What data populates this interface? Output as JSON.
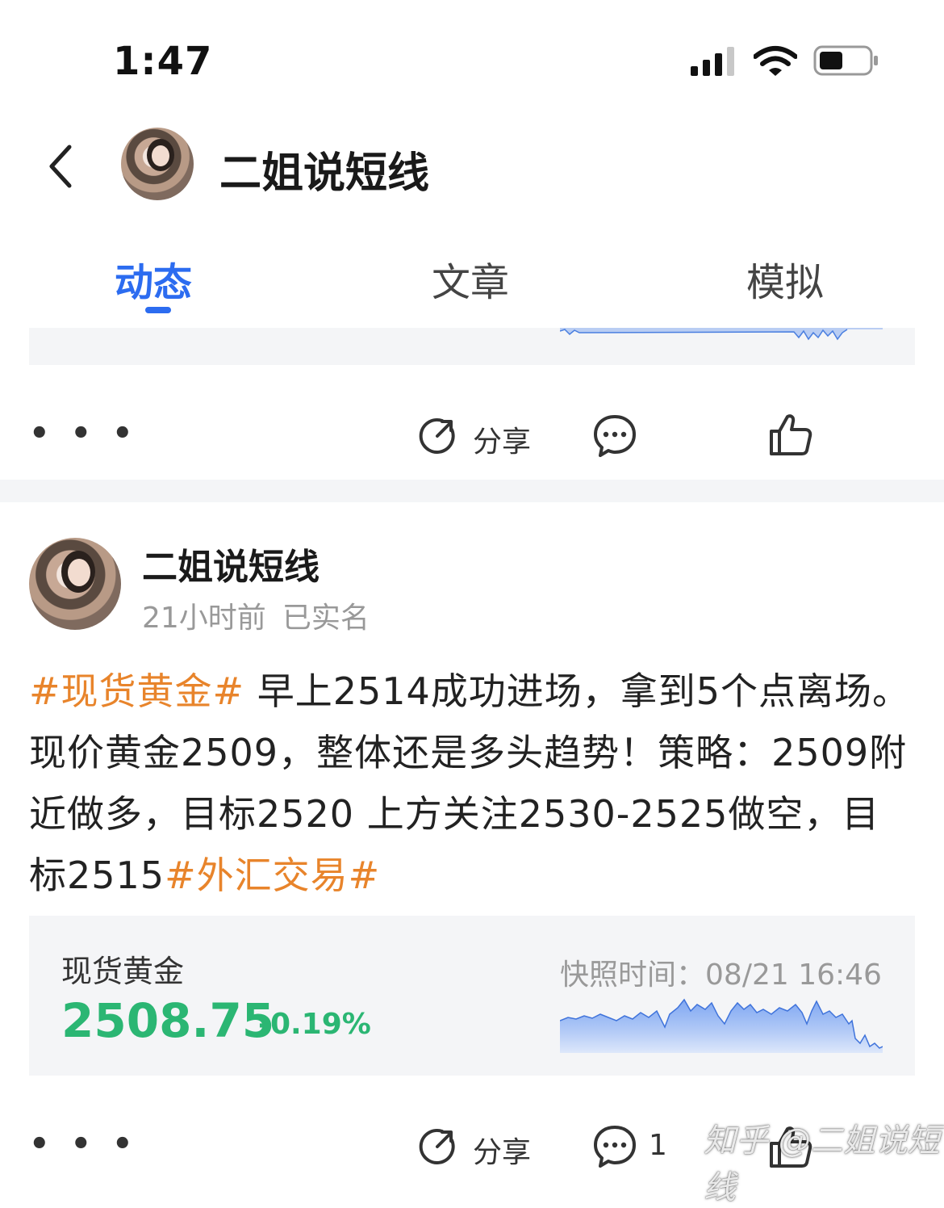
{
  "status_bar": {
    "time": "1:47"
  },
  "header": {
    "title": "二姐说短线"
  },
  "tabs": [
    {
      "label": "动态",
      "active": true
    },
    {
      "label": "文章",
      "active": false
    },
    {
      "label": "模拟",
      "active": false
    }
  ],
  "post1_actions": {
    "more": "• • •",
    "share_label": "分享"
  },
  "post2": {
    "author": "二姐说短线",
    "time": "21小时前",
    "verified": "已实名",
    "body": {
      "tag1": "#现货黄金#",
      "text1": " 早上2514成功进场，拿到5个点离场。现价黄金2509，整体还是多头趋势！策略：2509附近做多，目标2520 上方关注2530-2525做空，目标2515",
      "tag2": "#外汇交易#"
    },
    "quote": {
      "name": "现货黄金",
      "price": "2508.75",
      "change": "-0.19%",
      "snapshot_label": "快照时间：",
      "snapshot_time": "08/21 16:46"
    },
    "actions": {
      "more": "• • •",
      "share_label": "分享",
      "comment_count": "1"
    }
  },
  "watermark": "知乎 @二姐说短线",
  "colors": {
    "accent": "#2c6cf0",
    "tag": "#e8842b",
    "price_down": "#2bb673"
  },
  "icons": [
    "back-icon",
    "signal-icon",
    "wifi-icon",
    "battery-icon",
    "share-icon",
    "comment-icon",
    "like-icon"
  ]
}
